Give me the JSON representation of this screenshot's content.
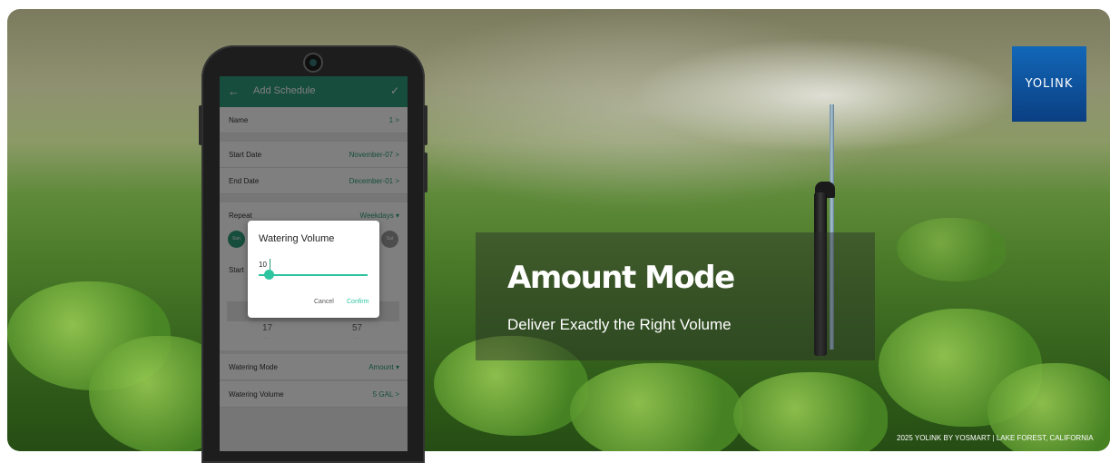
{
  "brand": {
    "logo_text": "YOLINK"
  },
  "hero": {
    "headline": "Amount Mode",
    "subheadline": "Deliver Exactly the Right Volume",
    "credit": "2025 YOLINK BY YOSMART | LAKE FOREST, CALIFORNIA"
  },
  "app": {
    "title": "Add Schedule",
    "back_icon": "←",
    "save_icon": "✓",
    "fields": {
      "name": {
        "label": "Name",
        "value": "1 >"
      },
      "start_date": {
        "label": "Start Date",
        "value": "November-07 >"
      },
      "end_date": {
        "label": "End Date",
        "value": "December-01 >"
      },
      "repeat": {
        "label": "Repeat",
        "value": "Weekdays ▾"
      },
      "start": {
        "label": "Start"
      },
      "watering_mode": {
        "label": "Watering Mode",
        "value": "Amount ▾"
      },
      "watering_volume": {
        "label": "Watering Volume",
        "value": "5 GAL >"
      }
    },
    "days": {
      "first": "Sun",
      "last": "Sat"
    },
    "time_picker": {
      "hour": "17",
      "minute": "57"
    },
    "dialog": {
      "title": "Watering Volume",
      "input_value": "10",
      "slider_fraction": 0.1,
      "cancel_label": "Cancel",
      "confirm_label": "Confirm"
    }
  },
  "colors": {
    "accent": "#2e9a79",
    "slider": "#2ec4a0",
    "logo_bg": "#0b4f9a"
  }
}
